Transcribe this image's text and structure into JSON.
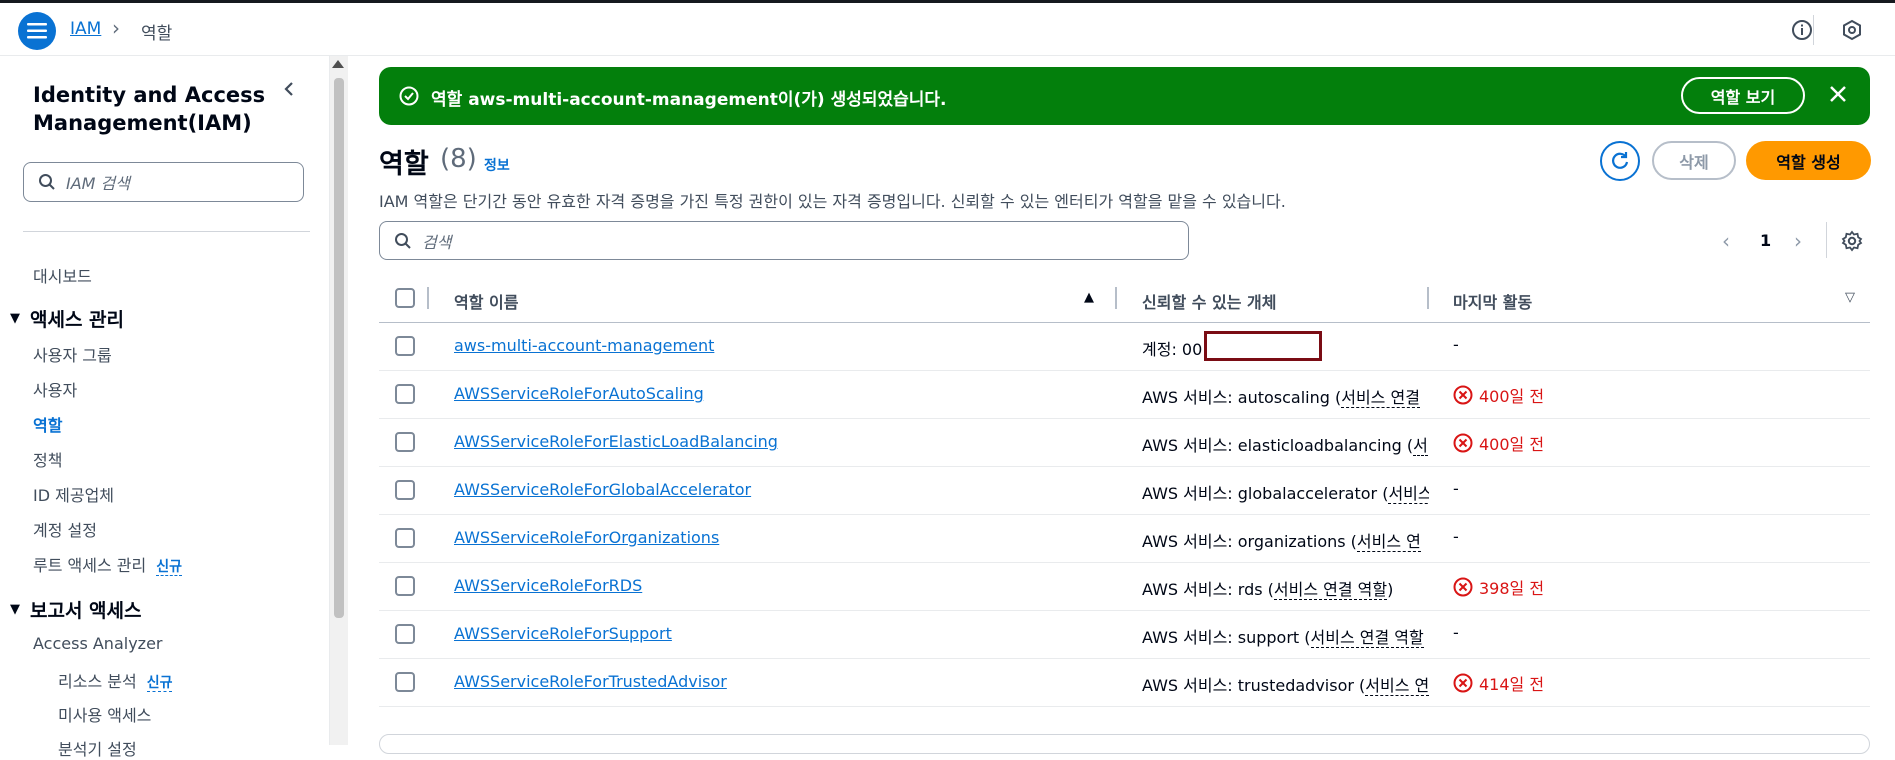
{
  "breadcrumb": {
    "root": "IAM",
    "current": "역할"
  },
  "sidebar": {
    "title": "Identity and Access Management(IAM)",
    "search_placeholder": "IAM 검색",
    "dashboard": "대시보드",
    "section_access": "액세스 관리",
    "items": [
      "사용자 그룹",
      "사용자",
      "역할",
      "정책",
      "ID 제공업체",
      "계정 설정",
      "루트 액세스 관리"
    ],
    "new_badge": "신규",
    "section_reports": "보고서 액세스",
    "access_analyzer": "Access Analyzer",
    "sub_items": [
      "리소스 분석",
      "미사용 액세스",
      "분석기 설정"
    ]
  },
  "flash": {
    "message": "역할 aws-multi-account-management이(가) 생성되었습니다.",
    "view_button": "역할 보기"
  },
  "header": {
    "title": "역할",
    "count": "(8)",
    "info": "정보",
    "description": "IAM 역할은 단기간 동안 유효한 자격 증명을 가진 특정 권한이 있는 자격 증명입니다. 신뢰할 수 있는 엔터티가 역할을 맡을 수 있습니다.",
    "delete_button": "삭제",
    "create_button": "역할 생성"
  },
  "search": {
    "placeholder": "검색"
  },
  "pagination": {
    "page": "1"
  },
  "table": {
    "columns": [
      "역할 이름",
      "신뢰할 수 있는 개체",
      "마지막 활동"
    ],
    "rows": [
      {
        "name": "aws-multi-account-management",
        "trust_prefix": "계정: 00",
        "trust_link": "",
        "activity": "-",
        "error": false
      },
      {
        "name": "AWSServiceRoleForAutoScaling",
        "trust_prefix": "AWS 서비스: autoscaling (",
        "trust_link": "서비스 연결",
        "activity": "400일 전",
        "error": true
      },
      {
        "name": "AWSServiceRoleForElasticLoadBalancing",
        "trust_prefix": "AWS 서비스: elasticloadbalancing (",
        "trust_link": "서",
        "activity": "400일 전",
        "error": true
      },
      {
        "name": "AWSServiceRoleForGlobalAccelerator",
        "trust_prefix": "AWS 서비스: globalaccelerator (",
        "trust_link": "서비스",
        "activity": "-",
        "error": false
      },
      {
        "name": "AWSServiceRoleForOrganizations",
        "trust_prefix": "AWS 서비스: organizations (",
        "trust_link": "서비스 연",
        "activity": "-",
        "error": false
      },
      {
        "name": "AWSServiceRoleForRDS",
        "trust_prefix": "AWS 서비스: rds (",
        "trust_link": "서비스 연결 역할",
        "trust_suffix": ")",
        "activity": "398일 전",
        "error": true
      },
      {
        "name": "AWSServiceRoleForSupport",
        "trust_prefix": "AWS 서비스: support (",
        "trust_link": "서비스 연결 역할",
        "activity": "-",
        "error": false
      },
      {
        "name": "AWSServiceRoleForTrustedAdvisor",
        "trust_prefix": "AWS 서비스: trustedadvisor (",
        "trust_link": "서비스 연",
        "activity": "414일 전",
        "error": true
      }
    ]
  },
  "colors": {
    "accent": "#0972d3",
    "success": "#037f0c",
    "primary": "#ff9900",
    "error": "#d91515"
  }
}
